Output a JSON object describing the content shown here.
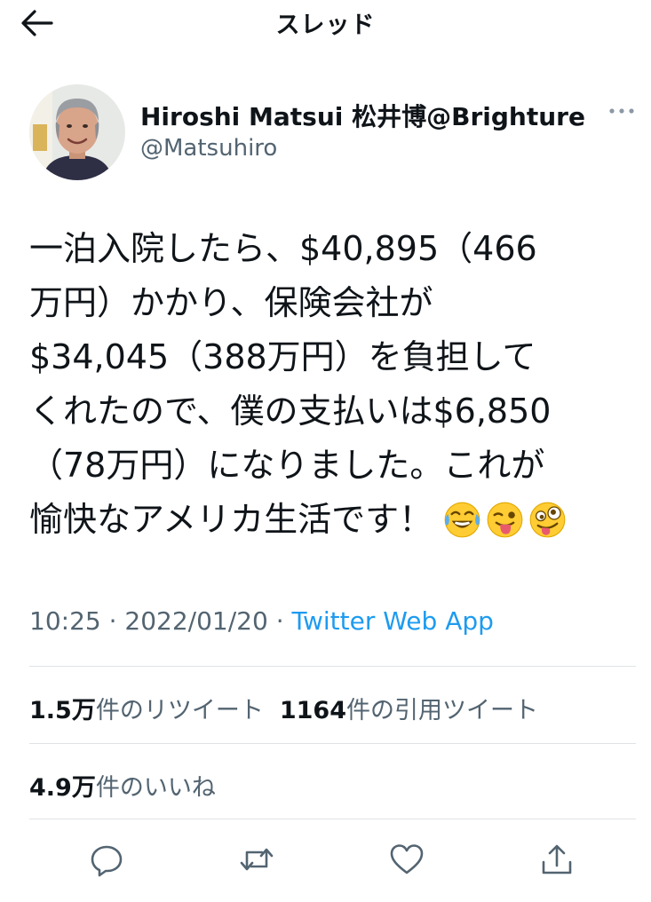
{
  "header": {
    "title": "スレッド",
    "back_icon": "arrow-left-icon"
  },
  "author": {
    "name": "Hiroshi Matsui 松井博@Brighture",
    "handle": "@Matsuhiro",
    "more_icon": "more-horizontal-icon"
  },
  "tweet": {
    "lines": [
      "一泊入院したら、$40,895（466",
      "万円）かかり、保険会社が",
      "$34,045（388万円）を負担して",
      "くれたので、僕の支払いは$6,850",
      "（78万円）になりました。これが",
      "愉快なアメリカ生活です！"
    ],
    "emojis": [
      "face-with-tears-of-joy",
      "winking-face-with-tongue",
      "zany-face"
    ]
  },
  "meta": {
    "time": "10:25",
    "separator": " · ",
    "date": "2022/01/20",
    "source": "Twitter Web App"
  },
  "stats": {
    "retweets_count": "1.5万",
    "retweets_label": "件のリツイート",
    "quotes_count": "1164",
    "quotes_label": "件の引用ツイート",
    "likes_count": "4.9万",
    "likes_label": "件のいいね"
  },
  "actions": [
    "reply-icon",
    "retweet-icon",
    "like-icon",
    "share-icon"
  ],
  "colors": {
    "text": "#0f1419",
    "secondary": "#536471",
    "link": "#1d9bf0",
    "divider": "#dfe3e6"
  }
}
